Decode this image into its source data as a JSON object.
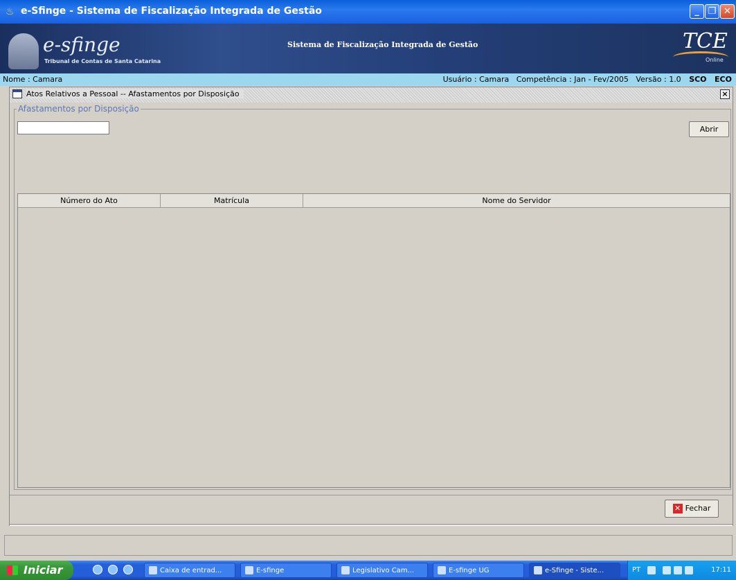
{
  "window": {
    "title": "e-Sfinge - Sistema de Fiscalização Integrada de Gestão"
  },
  "banner": {
    "logo": "e-sfinge",
    "logo_subtitle": "Tribunal de Contas de Santa Catarina",
    "title": "Sistema de Fiscalização Integrada de Gestão",
    "tce_logo": "TCE",
    "tce_online": "Online"
  },
  "infobar": {
    "nome": "Nome : Camara",
    "usuario": "Usuário : Camara",
    "competencia": "Competência : Jan - Fev/2005",
    "versao": "Versão : 1.0",
    "sco": "SCO",
    "eco": "ECO"
  },
  "internal_frame": {
    "title": "Atos Relativos a Pessoal -- Afastamentos por Disposição"
  },
  "group": {
    "legend": "Afastamentos por Disposição"
  },
  "search": {
    "value": ""
  },
  "buttons": {
    "abrir": "Abrir",
    "fechar": "Fechar"
  },
  "table": {
    "columns": [
      "Número do Ato",
      "Matrícula",
      "Nome do Servidor"
    ],
    "rows": []
  },
  "taskbar": {
    "start": "Iniciar",
    "tasks": [
      "Caixa de entrad...",
      "E-sfinge",
      "Legislativo Cam...",
      "E-sfinge UG",
      "e-Sfinge - Siste..."
    ],
    "lang": "PT",
    "clock": "17:11"
  }
}
